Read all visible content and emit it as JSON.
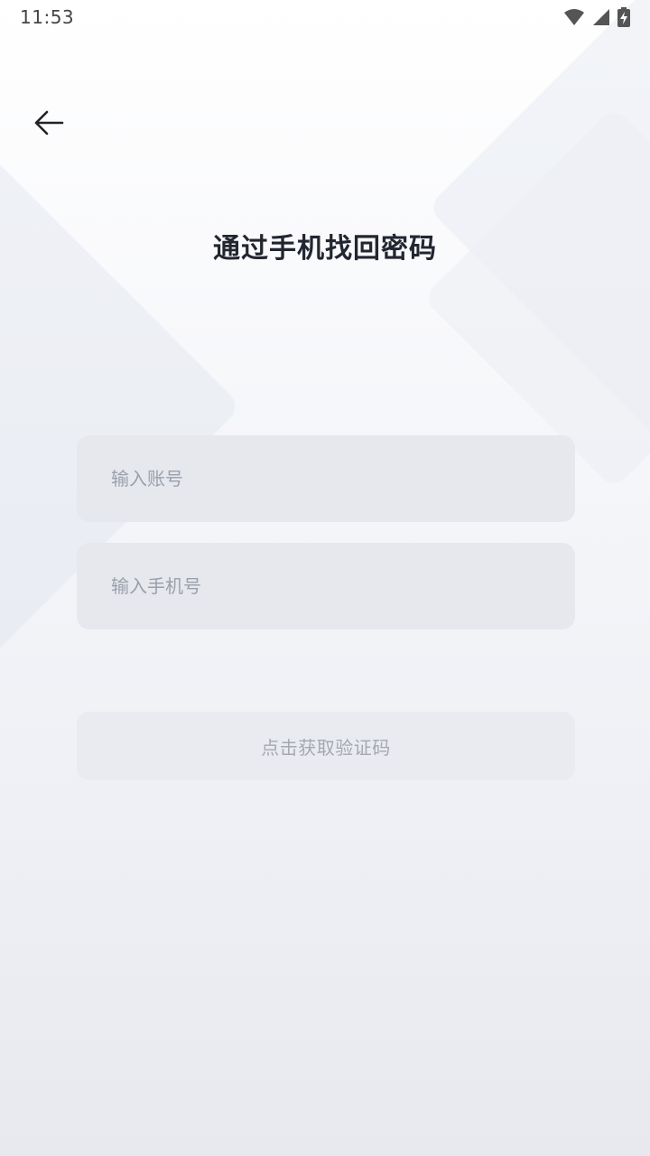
{
  "status_bar": {
    "time": "11:53",
    "icons": [
      "wifi-icon",
      "cellular-signal-icon",
      "battery-charging-icon"
    ]
  },
  "header": {
    "back_icon": "arrow-left-icon"
  },
  "page": {
    "title": "通过手机找回密码"
  },
  "form": {
    "account_placeholder": "输入账号",
    "account_value": "",
    "phone_placeholder": "输入手机号",
    "phone_value": "",
    "get_code_label": "点击获取验证码"
  },
  "colors": {
    "title": "#222631",
    "field_bg": "#e6e8ee",
    "placeholder": "#9aa0aa",
    "button_bg": "#e9ebf0",
    "button_text": "#a4a8b1"
  }
}
